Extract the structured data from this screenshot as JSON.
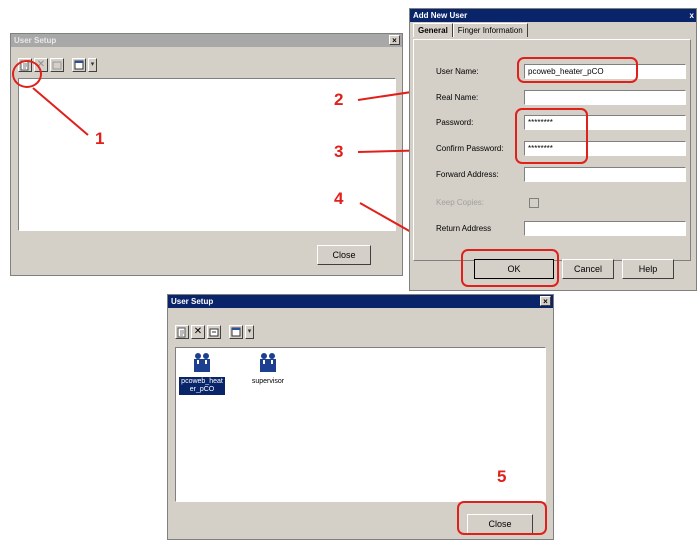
{
  "window1": {
    "title": "User Setup",
    "close_x": "×",
    "close_label": "Close"
  },
  "dialog": {
    "title": "Add New User",
    "close_x": "x",
    "tabs": [
      "General",
      "Finger Information"
    ],
    "fields": {
      "user_name": {
        "label": "User Name:",
        "value": "pcoweb_heater_pCO"
      },
      "real_name": {
        "label": "Real Name:",
        "value": ""
      },
      "password": {
        "label": "Password:",
        "value": "********"
      },
      "confirm_password": {
        "label": "Confirm Password:",
        "value": "********"
      },
      "forward_address": {
        "label": "Forward Address:",
        "value": ""
      },
      "keep_copies": {
        "label": "Keep Copies:"
      },
      "return_address": {
        "label": "Return Address",
        "value": ""
      }
    },
    "buttons": {
      "ok": "OK",
      "cancel": "Cancel",
      "help": "Help"
    }
  },
  "window2": {
    "title": "User Setup",
    "close_x": "×",
    "close_label": "Close",
    "users": [
      {
        "name": "pcoweb_heater_pCO",
        "selected": true
      },
      {
        "name": "supervisor",
        "selected": false
      }
    ]
  },
  "callouts": [
    "1",
    "2",
    "3",
    "4",
    "5"
  ],
  "colors": {
    "callout": "#e0201a",
    "active_title": "#0a246a",
    "inactive_title": "#a8a8a8"
  },
  "icons": [
    "new-user-icon",
    "delete-icon",
    "properties-icon",
    "view-icon",
    "dropdown-arrow-icon",
    "users-icon"
  ]
}
